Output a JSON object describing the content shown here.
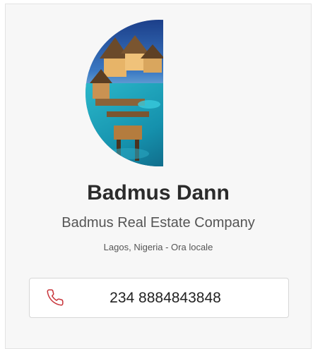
{
  "contact": {
    "name": "Badmus Dann",
    "company": "Badmus Real Estate Company",
    "location": "Lagos, Nigeria - Ora locale",
    "phone": "234 8884843848",
    "avatar_image": "overwater-bungalows-photo",
    "phone_icon": "phone-icon"
  },
  "colors": {
    "card_background": "#f7f7f7",
    "phone_icon": "#c8343a",
    "name_text": "#2b2b2b"
  }
}
